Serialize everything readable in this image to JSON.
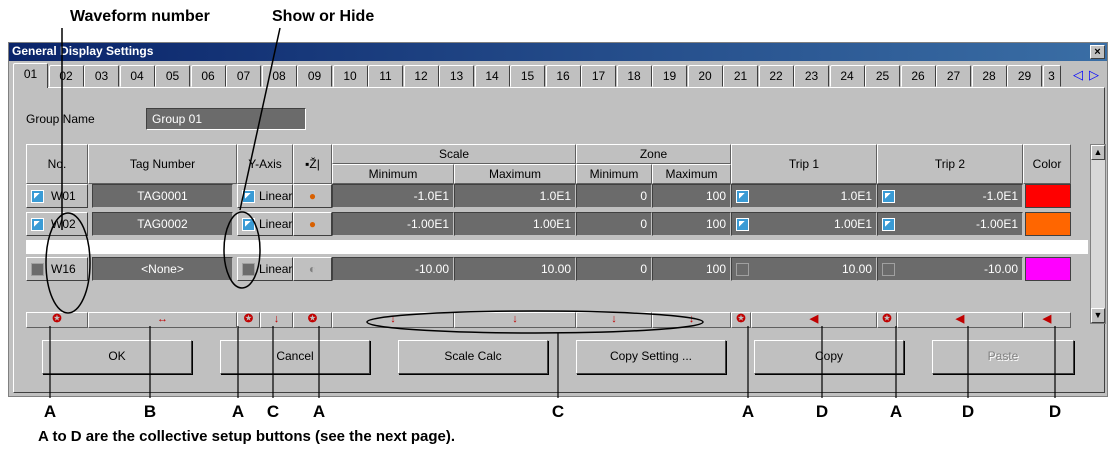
{
  "callouts": {
    "waveform_number": "Waveform number",
    "show_hide": "Show or Hide",
    "footnote": "A to D are the collective setup buttons (see the next page)."
  },
  "letters": [
    "A",
    "B",
    "A",
    "C",
    "A",
    "C",
    "A",
    "D",
    "A",
    "D",
    "D"
  ],
  "window": {
    "title": "General Display Settings",
    "close_glyph": "×"
  },
  "tabs": [
    "01",
    "02",
    "03",
    "04",
    "05",
    "06",
    "07",
    "08",
    "09",
    "10",
    "11",
    "12",
    "13",
    "14",
    "15",
    "16",
    "17",
    "18",
    "19",
    "20",
    "21",
    "22",
    "23",
    "24",
    "25",
    "26",
    "27",
    "28",
    "29",
    "3"
  ],
  "tab_nav": {
    "prev": "◁",
    "next": "▷"
  },
  "group": {
    "label": "Group Name",
    "value": "Group 01"
  },
  "headers": {
    "no": "No.",
    "tag_number": "Tag Number",
    "y_axis": "Y-Axis",
    "marker": "▪Ž|",
    "scale": "Scale",
    "zone": "Zone",
    "minimum": "Minimum",
    "maximum": "Maximum",
    "trip1": "Trip 1",
    "trip2": "Trip 2",
    "color": "Color"
  },
  "rows": [
    {
      "no": "W01",
      "show": true,
      "tag": "TAG0001",
      "y_axis": "Linear",
      "scale_min": "-1.0E1",
      "scale_max": "1.0E1",
      "zone_min": "0",
      "zone_max": "100",
      "trip1_on": true,
      "trip1": "1.0E1",
      "trip2_on": true,
      "trip2": "-1.0E1",
      "color": "#ff0000"
    },
    {
      "no": "W02",
      "show": true,
      "tag": "TAG0002",
      "y_axis": "Linear",
      "scale_min": "-1.00E1",
      "scale_max": "1.00E1",
      "zone_min": "0",
      "zone_max": "100",
      "trip1_on": true,
      "trip1": "1.00E1",
      "trip2_on": true,
      "trip2": "-1.00E1",
      "color": "#ff6600"
    },
    {
      "no": "W16",
      "show": false,
      "tag": "<None>",
      "y_axis": "Linear",
      "scale_min": "-10.00",
      "scale_max": "10.00",
      "zone_min": "0",
      "zone_max": "100",
      "trip1_on": false,
      "trip1": "10.00",
      "trip2_on": false,
      "trip2": "-10.00",
      "color": "#ff00ff"
    }
  ],
  "batch_glyphs": {
    "reset": "✪",
    "arrows": "↔",
    "down": "↓",
    "first": "◀"
  },
  "buttons": {
    "ok": "OK",
    "cancel": "Cancel",
    "scale_calc": "Scale Calc",
    "copy_setting": "Copy Setting ...",
    "copy": "Copy",
    "paste": "Paste"
  },
  "icons": {
    "y_axis_marker": "bar-marker-icon",
    "line_type": "line-type-icon",
    "checkbox": "checkbox-icon"
  }
}
